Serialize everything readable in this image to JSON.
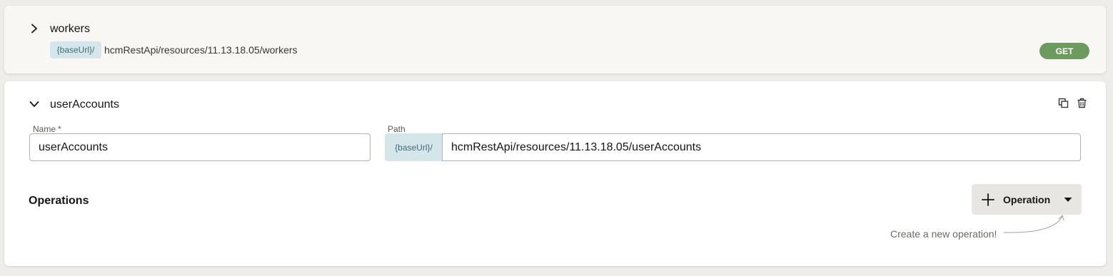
{
  "resources": {
    "workers": {
      "name": "workers",
      "base_url": "{baseUrl}/",
      "path": "hcmRestApi/resources/11.13.18.05/workers",
      "method_badge": "GET"
    },
    "user_accounts": {
      "name": "userAccounts",
      "name_label": "Name",
      "required_marker": "*",
      "name_value": "userAccounts",
      "path_label": "Path",
      "base_url": "{baseUrl}/",
      "path_value": "hcmRestApi/resources/11.13.18.05/userAccounts",
      "operations_heading": "Operations",
      "add_operation_label": "Operation",
      "hint": "Create a new operation!"
    }
  },
  "icons": {
    "expand": "chevron-right-icon",
    "collapse": "chevron-down-icon",
    "duplicate": "copy-icon",
    "delete": "trash-icon",
    "add": "plus-icon",
    "dropdown": "caret-down-icon"
  },
  "colors": {
    "get_badge": "#6d9a5f",
    "base_url_chip": "#d4e6ea",
    "base_url_text": "#3f6c7a",
    "page_background": "#efedea"
  }
}
